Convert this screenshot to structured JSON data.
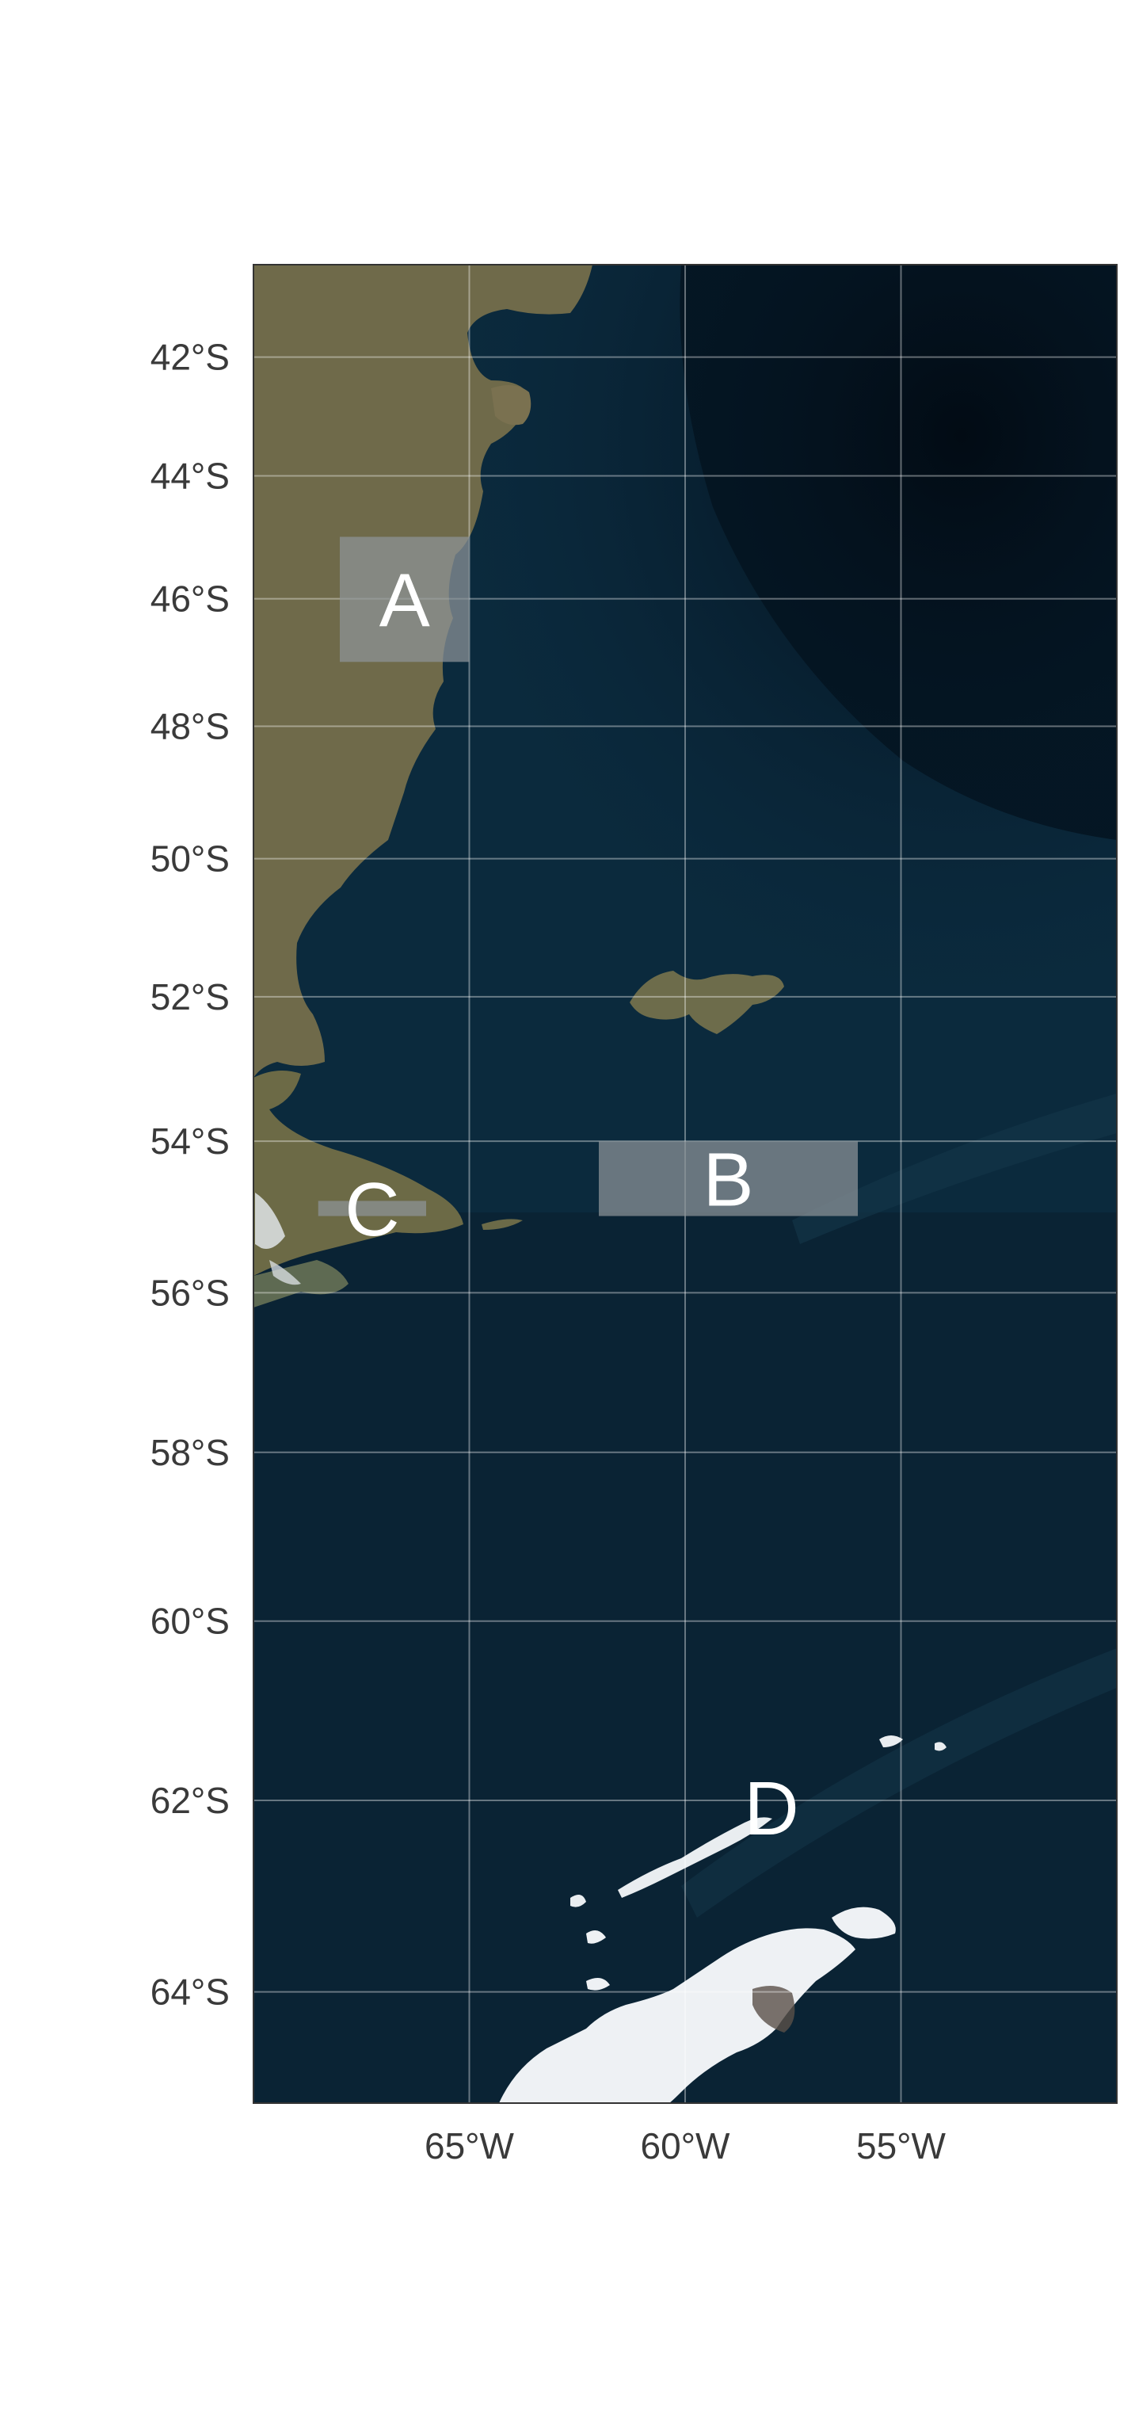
{
  "map": {
    "lat_range": [
      -65.1,
      -40.4
    ],
    "lon_range": [
      -70.0,
      -50.0
    ],
    "lat_ticks": [
      {
        "value": -42,
        "label": "42°S"
      },
      {
        "value": -44,
        "label": "44°S"
      },
      {
        "value": -46,
        "label": "46°S"
      },
      {
        "value": -48,
        "label": "48°S"
      },
      {
        "value": -50,
        "label": "50°S"
      },
      {
        "value": -52,
        "label": "52°S"
      },
      {
        "value": -54,
        "label": "54°S"
      },
      {
        "value": -56,
        "label": "56°S"
      },
      {
        "value": -58,
        "label": "58°S"
      },
      {
        "value": -60,
        "label": "60°S"
      },
      {
        "value": -62,
        "label": "62°S"
      },
      {
        "value": -64,
        "label": "64°S"
      }
    ],
    "lon_ticks": [
      {
        "value": -65,
        "label": "65°W"
      },
      {
        "value": -60,
        "label": "60°W"
      },
      {
        "value": -55,
        "label": "55°W"
      }
    ],
    "regions": [
      {
        "label": "A",
        "lon": [
          -68,
          -65
        ],
        "lat": [
          -47,
          -45
        ],
        "box": true
      },
      {
        "label": "B",
        "lon": [
          -62,
          -56
        ],
        "lat": [
          -55,
          -54
        ],
        "box": true
      },
      {
        "label": "C",
        "lon": [
          -68.5,
          -66
        ],
        "lat": [
          -55,
          -54.8
        ],
        "box": true
      },
      {
        "label": "D",
        "lon": [
          -58,
          -58
        ],
        "lat": [
          -62,
          -62
        ],
        "box": false
      }
    ],
    "colors": {
      "ocean": "#0c2a3c",
      "deep_ocean": "#051422",
      "land": "#6f6a4a",
      "ice": "#f2f4f6",
      "region_fill": "#8d9499"
    }
  }
}
